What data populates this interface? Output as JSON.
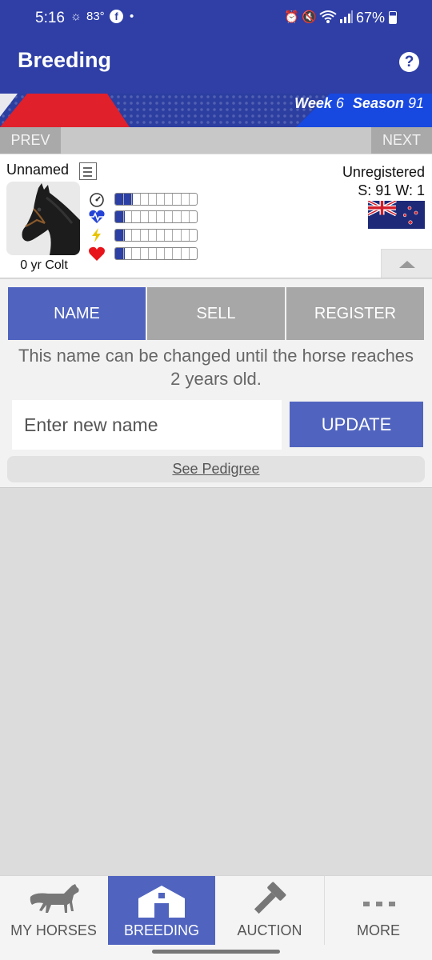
{
  "status_bar": {
    "time": "5:16",
    "temperature": "83°",
    "dot": "•",
    "battery": "67%",
    "icons": [
      "weather-icon",
      "facebook-icon",
      "alarm-icon",
      "mute-icon",
      "wifi-icon",
      "signal-icon",
      "battery-icon"
    ]
  },
  "app_bar": {
    "title": "Breeding",
    "help_glyph": "?"
  },
  "banner": {
    "week_label": "Week",
    "week_value": "6",
    "season_label": "Season",
    "season_value": "91"
  },
  "pager": {
    "prev_label": "PREV",
    "next_label": "NEXT"
  },
  "horse": {
    "name": "Unnamed",
    "age_sex": "0 yr Colt",
    "registration": "Unregistered",
    "season_week": "S: 91 W: 1",
    "flag": "new-zealand-flag",
    "stats": [
      {
        "icon": "speedometer-icon",
        "fill": 0.22,
        "color": "#2b3fa4"
      },
      {
        "icon": "heartbeat-icon",
        "fill": 0.12,
        "color": "#2b3fa4"
      },
      {
        "icon": "lightning-icon",
        "fill": 0.12,
        "color": "#2b3fa4"
      },
      {
        "icon": "heart-icon",
        "fill": 0.12,
        "color": "#2b3fa4"
      }
    ]
  },
  "actions": {
    "tabs": [
      "NAME",
      "SELL",
      "REGISTER"
    ],
    "active_tab": "NAME",
    "note": "This name can be changed until the horse reaches 2 years old.",
    "name_placeholder": "Enter new name",
    "update_label": "UPDATE",
    "pedigree_link": "See Pedigree"
  },
  "bottom_nav": {
    "items": [
      {
        "label": "MY HORSES",
        "icon": "horse-icon"
      },
      {
        "label": "BREEDING",
        "icon": "barn-icon"
      },
      {
        "label": "AUCTION",
        "icon": "gavel-icon"
      },
      {
        "label": "MORE",
        "icon": "more-dots-icon"
      }
    ],
    "active": "BREEDING"
  },
  "colors": {
    "primary": "#2f3fa6",
    "accent": "#5064bf",
    "inactive_tab": "#a7a7a7",
    "banner_red": "#e0202a"
  }
}
